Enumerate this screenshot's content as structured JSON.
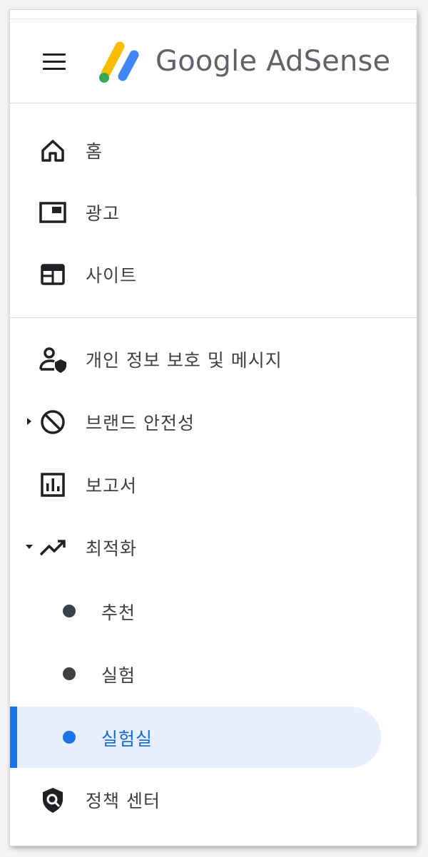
{
  "header": {
    "brand_google": "Google",
    "brand_product": "AdSense"
  },
  "nav": {
    "home": {
      "label": "홈",
      "icon": "home-icon"
    },
    "ads": {
      "label": "광고",
      "icon": "ads-icon"
    },
    "sites": {
      "label": "사이트",
      "icon": "sites-icon"
    },
    "privacy": {
      "label": "개인 정보 보호 및 메시지",
      "icon": "privacy-messaging-icon"
    },
    "brand_safety": {
      "label": "브랜드 안전성",
      "icon": "block-icon",
      "expanded": false
    },
    "reports": {
      "label": "보고서",
      "icon": "bar-chart-icon"
    },
    "optimization": {
      "label": "최적화",
      "icon": "trending-up-icon",
      "expanded": true,
      "children": [
        {
          "label": "추천",
          "active": false
        },
        {
          "label": "실험",
          "active": false
        },
        {
          "label": "실험실",
          "active": true
        }
      ]
    },
    "policy": {
      "label": "정책 센터",
      "icon": "policy-center-icon"
    }
  },
  "colors": {
    "accent": "#1a73e8",
    "active_bg": "#e8f0fe",
    "text": "#3c4043",
    "logo_yellow": "#fbbc04",
    "logo_blue": "#4285f4",
    "logo_green": "#34a853"
  }
}
